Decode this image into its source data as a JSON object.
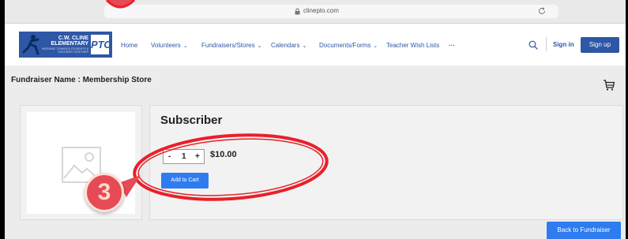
{
  "browser": {
    "url": "clinepto.com"
  },
  "logo": {
    "line1": "C.W. CLINE",
    "line2": "ELEMENTARY",
    "line3": "WORKING TOWARDS STUDENTS & TEACHERS TOGETHER",
    "pto": "PTO"
  },
  "nav": {
    "home": "Home",
    "volunteers": "Volunteers",
    "fundraisers": "Fundraisers/Stores",
    "calendars": "Calendars",
    "documents": "Documents/Forms",
    "wishlists": "Teacher Wish Lists",
    "more": "···",
    "chevron": "⌄"
  },
  "header": {
    "sign_in": "Sign in",
    "sign_up": "Sign up"
  },
  "page": {
    "title": "Fundraiser Name : Membership Store"
  },
  "product": {
    "name": "Subscriber",
    "qty_minus": "-",
    "qty_value": "1",
    "qty_plus": "+",
    "price": "$10.00",
    "add_to_cart": "Add to Cart"
  },
  "footer": {
    "back_to_fundraiser": "Back to Fundraiser"
  },
  "annotation": {
    "step_number": "3"
  },
  "colors": {
    "brand_blue": "#2e57a5",
    "button_blue": "#2e7cf0",
    "annotation_red": "#e8202a"
  }
}
